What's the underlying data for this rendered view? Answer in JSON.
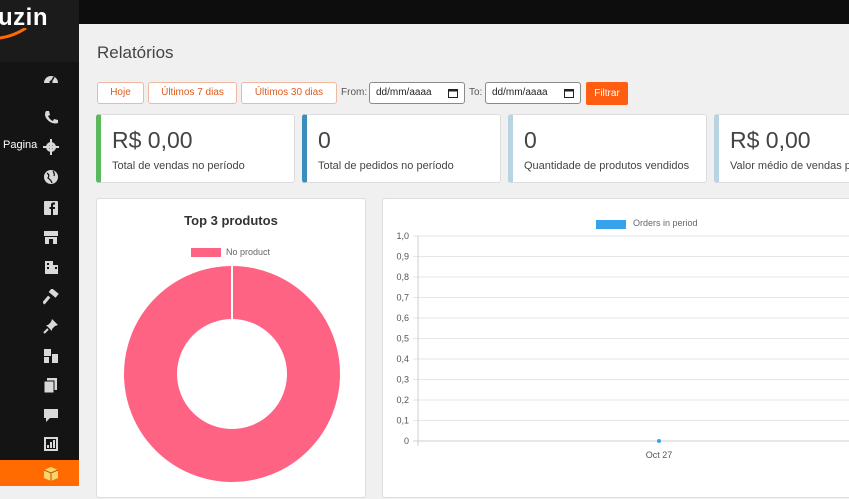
{
  "sidebar": {
    "logo": "uzin",
    "item_label": "Pagina",
    "icons": [
      "dashboard-icon",
      "phone-icon",
      "gear-icon",
      "globe-icon",
      "facebook-icon",
      "store-icon",
      "building-icon",
      "hammer-icon",
      "pin-icon",
      "layout-icon",
      "copy-icon",
      "comment-icon",
      "report-icon",
      "package-icon"
    ],
    "active_color": "#ff6b00"
  },
  "page": {
    "title": "Relatórios"
  },
  "filters": {
    "buttons": [
      "Hoje",
      "Últimos 7 dias",
      "Últimos 30 dias"
    ],
    "from_label": "From:",
    "to_label": "To:",
    "from_value": "dd/mm/aaaa",
    "to_value": "dd/mm/aaaa",
    "submit": "Filtrar",
    "accent": "#ff5d12"
  },
  "cards": [
    {
      "value": "R$ 0,00",
      "caption": "Total de vendas no período",
      "color": "#5cb85c"
    },
    {
      "value": "0",
      "caption": "Total de pedidos no período",
      "color": "#3c8dbc"
    },
    {
      "value": "0",
      "caption": "Quantidade de produtos vendidos",
      "color": "#b8d4e3"
    },
    {
      "value": "R$ 0,00",
      "caption": "Valor médio de vendas por",
      "color": "#b8d4e3"
    }
  ],
  "chart_data": [
    {
      "type": "pie",
      "title": "Top 3 produtos",
      "categories": [
        "No product"
      ],
      "values": [
        1
      ],
      "colors": [
        "#ff6384"
      ],
      "legend": "top"
    },
    {
      "type": "line",
      "title": "",
      "series": [
        {
          "name": "Orders in period",
          "values": [
            0
          ],
          "color": "#36a2eb"
        }
      ],
      "x": [
        "Oct 27"
      ],
      "yticks": [
        "1,0",
        "0,9",
        "0,8",
        "0,7",
        "0,6",
        "0,5",
        "0,4",
        "0,3",
        "0,2",
        "0,1",
        "0"
      ],
      "ylim": [
        0,
        1
      ],
      "grid": true,
      "legend": "top"
    }
  ]
}
